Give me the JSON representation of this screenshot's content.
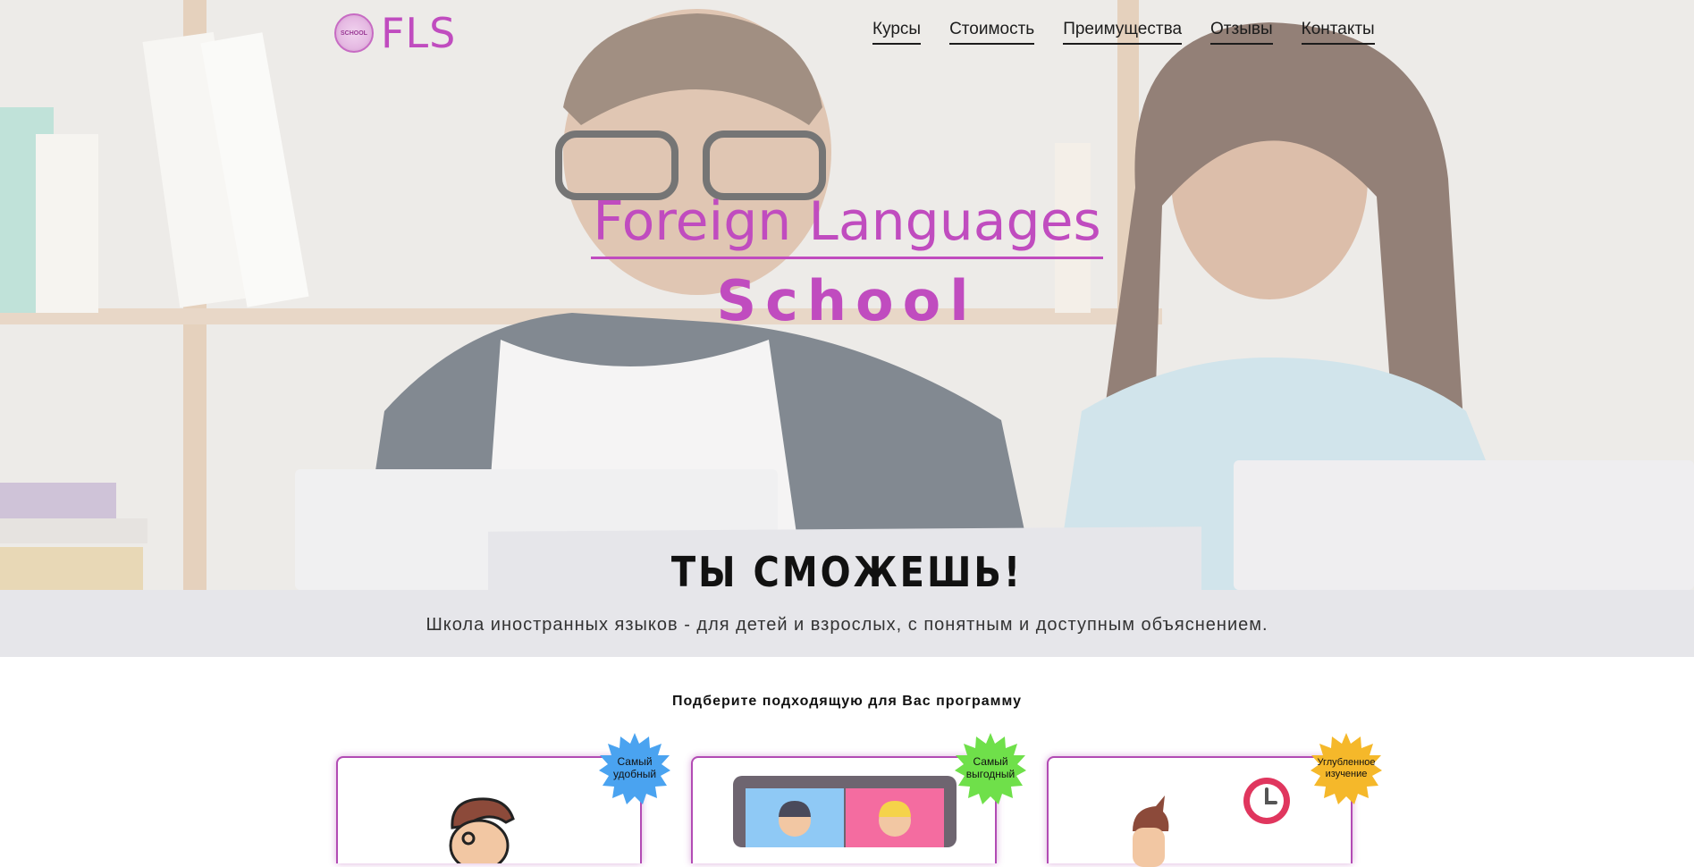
{
  "header": {
    "logo_badge_text": "SCHOOL",
    "logo_text": "FLS",
    "nav": [
      "Курсы",
      "Стоимость",
      "Преимущества",
      "Отзывы",
      "Контакты"
    ]
  },
  "hero": {
    "title_line1": "Foreign Languages",
    "title_line2": "School",
    "slogan": "ТЫ СМОЖЕШЬ!",
    "subtitle": "Школа иностранных языков - для детей и взрослых, с понятным и доступным объяснением."
  },
  "programs": {
    "heading": "Подберите подходящую для Вас программу",
    "cards": [
      {
        "badge": "Самый удобный",
        "badge_color": "#4aa3f0"
      },
      {
        "badge": "Самый выгодный",
        "badge_color": "#6fe04a"
      },
      {
        "badge": "Углубленное изучение",
        "badge_color": "#f5b82a"
      }
    ]
  },
  "colors": {
    "accent": "#c04cbf",
    "card_border": "#b24bb4"
  }
}
